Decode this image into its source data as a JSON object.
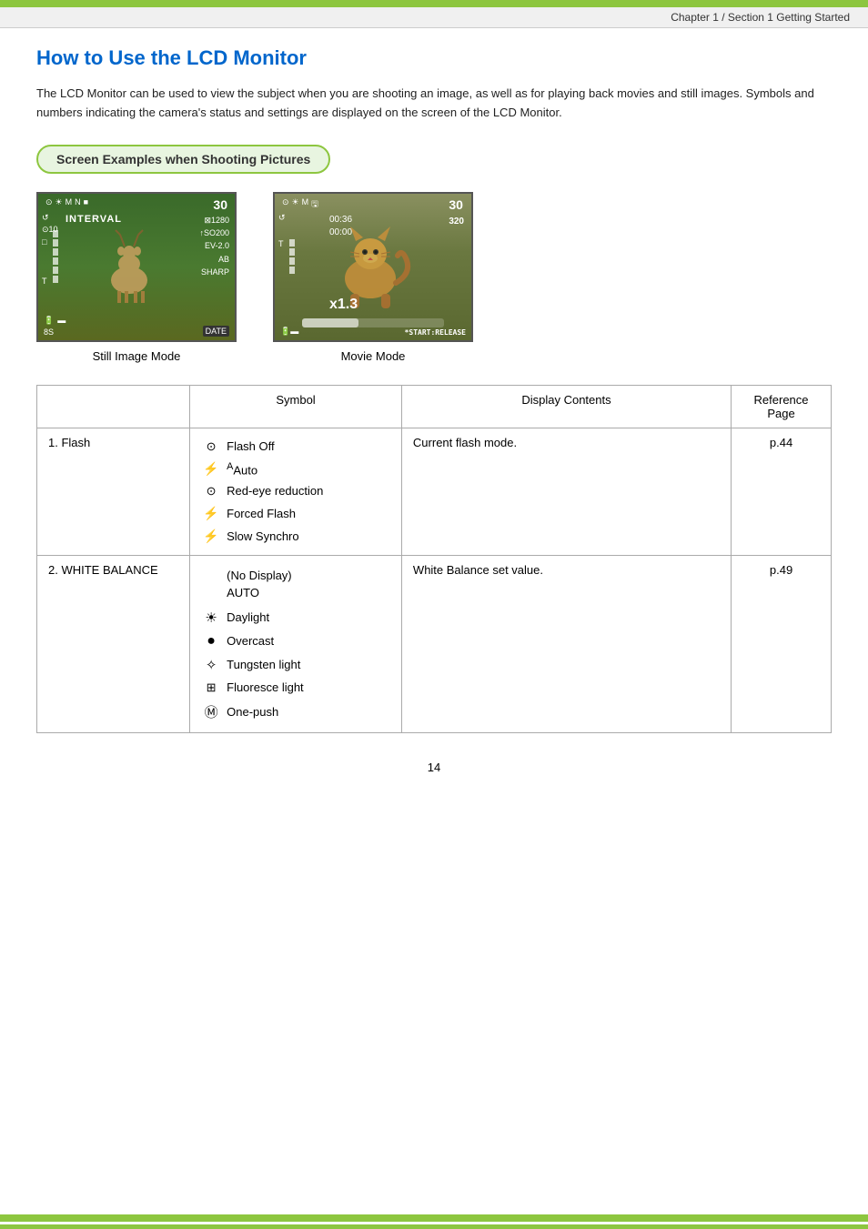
{
  "top_bar": {},
  "chapter_header": {
    "text": "Chapter 1 / Section 1 Getting Started"
  },
  "page_title": "How to Use the LCD Monitor",
  "intro_text": "The LCD Monitor can be used to view the subject when you are shooting an image, as well as for playing back movies and still images. Symbols and numbers indicating the camera's status and settings are displayed on the screen of the LCD Monitor.",
  "section_header": "Screen Examples when Shooting Pictures",
  "screens": [
    {
      "label": "Still Image Mode",
      "type": "still"
    },
    {
      "label": "Movie Mode",
      "type": "movie"
    }
  ],
  "table": {
    "headers": {
      "col1": "",
      "col2": "Symbol",
      "col3": "Display Contents",
      "col4": "Reference\nPage"
    },
    "rows": [
      {
        "item": "1. Flash",
        "symbols": [
          {
            "icon": "⊙",
            "label": "Flash Off"
          },
          {
            "icon": "⚡ᴬ",
            "label": "Auto"
          },
          {
            "icon": "⊙",
            "label": "Red-eye reduction"
          },
          {
            "icon": "⚡",
            "label": "Forced Flash"
          },
          {
            "icon": "⚡",
            "label": "Slow Synchro"
          }
        ],
        "display": "Current flash mode.",
        "ref": "p.44"
      },
      {
        "item": "2. WHITE BALANCE",
        "symbols": [
          {
            "icon": "",
            "label": "(No Display)\nAUTO",
            "combined": true
          },
          {
            "icon": "☀",
            "label": "Daylight"
          },
          {
            "icon": "●",
            "label": "Overcast"
          },
          {
            "icon": "✧",
            "label": "Tungsten light"
          },
          {
            "icon": "⊞",
            "label": "Fluoresce light"
          },
          {
            "icon": "Ⓜ",
            "label": "One-push"
          }
        ],
        "display": "White Balance set value.",
        "ref": "p.49"
      }
    ]
  },
  "page_number": "14"
}
